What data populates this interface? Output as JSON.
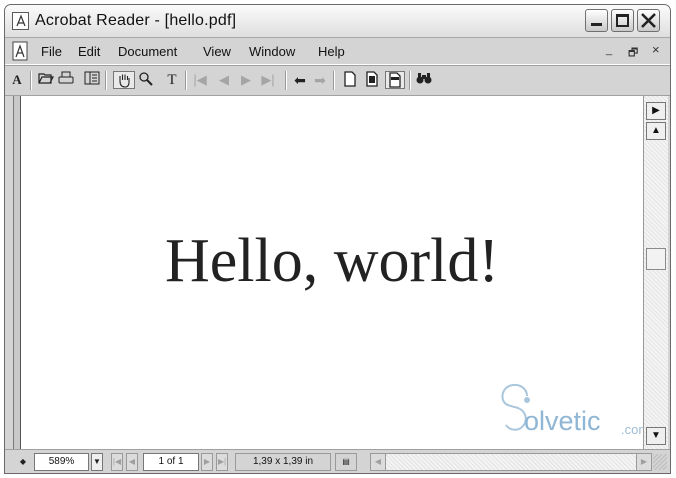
{
  "window": {
    "title": "Acrobat Reader - [hello.pdf]"
  },
  "menu": {
    "items": [
      "File",
      "Edit",
      "Document",
      "View",
      "Window",
      "Help"
    ],
    "mdi": [
      "_",
      "🗗",
      "×"
    ]
  },
  "toolbar": {
    "icons": [
      "text-select-icon",
      "open-icon",
      "print-icon",
      "show-hide-navigation-icon",
      "hand-tool-icon",
      "zoom-tool-icon",
      "text-tool-icon",
      "first-page-icon",
      "previous-page-icon",
      "next-page-icon",
      "last-page-icon",
      "go-back-icon",
      "go-forward-icon",
      "actual-size-icon",
      "fit-page-icon",
      "fit-width-icon",
      "find-icon"
    ]
  },
  "document": {
    "text": "Hello, world!"
  },
  "watermark": {
    "brand": "olvetic",
    "suffix": ".com"
  },
  "statusbar": {
    "zoom": "589%",
    "page": "1 of 1",
    "page_size": "1,39 x 1,39 in"
  },
  "colors": {
    "window_bg": "#d4d4d4",
    "page_bg": "#ffffff",
    "text": "#222222"
  }
}
